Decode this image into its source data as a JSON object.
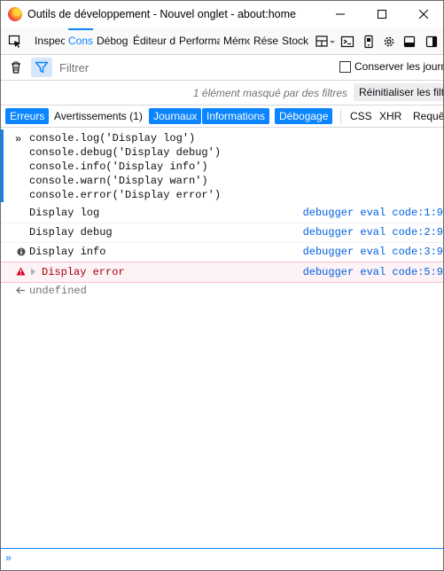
{
  "window": {
    "title": "Outils de développement - Nouvel onglet - about:home"
  },
  "toolbox": {
    "tabs": [
      {
        "label": "Inspecteur"
      },
      {
        "label": "Console",
        "active": true
      },
      {
        "label": "Débogueur"
      },
      {
        "label": "Éditeur de style"
      },
      {
        "label": "Performances"
      },
      {
        "label": "Mémoire"
      },
      {
        "label": "Réseau"
      },
      {
        "label": "Stockage"
      }
    ]
  },
  "filterbar": {
    "placeholder": "Filtrer",
    "persist_label": "Conserver les journaux",
    "persist_checked": false
  },
  "hidden_messages": {
    "text": "1 élément masqué par des filtres",
    "reset_label": "Réinitialiser les filtres"
  },
  "categories": [
    {
      "label": "Erreurs",
      "on": true
    },
    {
      "label": "Avertissements (1)",
      "on": false
    },
    {
      "label": "Journaux",
      "on": true
    },
    {
      "label": "Informations",
      "on": true
    },
    {
      "label": "Débogage",
      "on": true
    },
    {
      "label": "CSS",
      "on": false
    },
    {
      "label": "XHR",
      "on": false
    },
    {
      "label": "Requêtes",
      "on": false
    }
  ],
  "console": {
    "command_lines": [
      "console.log('Display log')",
      "console.debug('Display debug')",
      "console.info('Display info')",
      "console.warn('Display warn')",
      "console.error('Display error')"
    ],
    "messages": [
      {
        "type": "log",
        "text": "Display log",
        "location": "debugger eval code:1:9"
      },
      {
        "type": "debug",
        "text": "Display debug",
        "location": "debugger eval code:2:9"
      },
      {
        "type": "info",
        "text": "Display info",
        "location": "debugger eval code:3:9"
      },
      {
        "type": "error",
        "text": "Display error",
        "location": "debugger eval code:5:9"
      }
    ],
    "result": "undefined"
  },
  "colors": {
    "accent": "#0a84ff",
    "error_text": "#a4000f",
    "error_bg": "#fdf2f5",
    "link": "#0060df"
  }
}
